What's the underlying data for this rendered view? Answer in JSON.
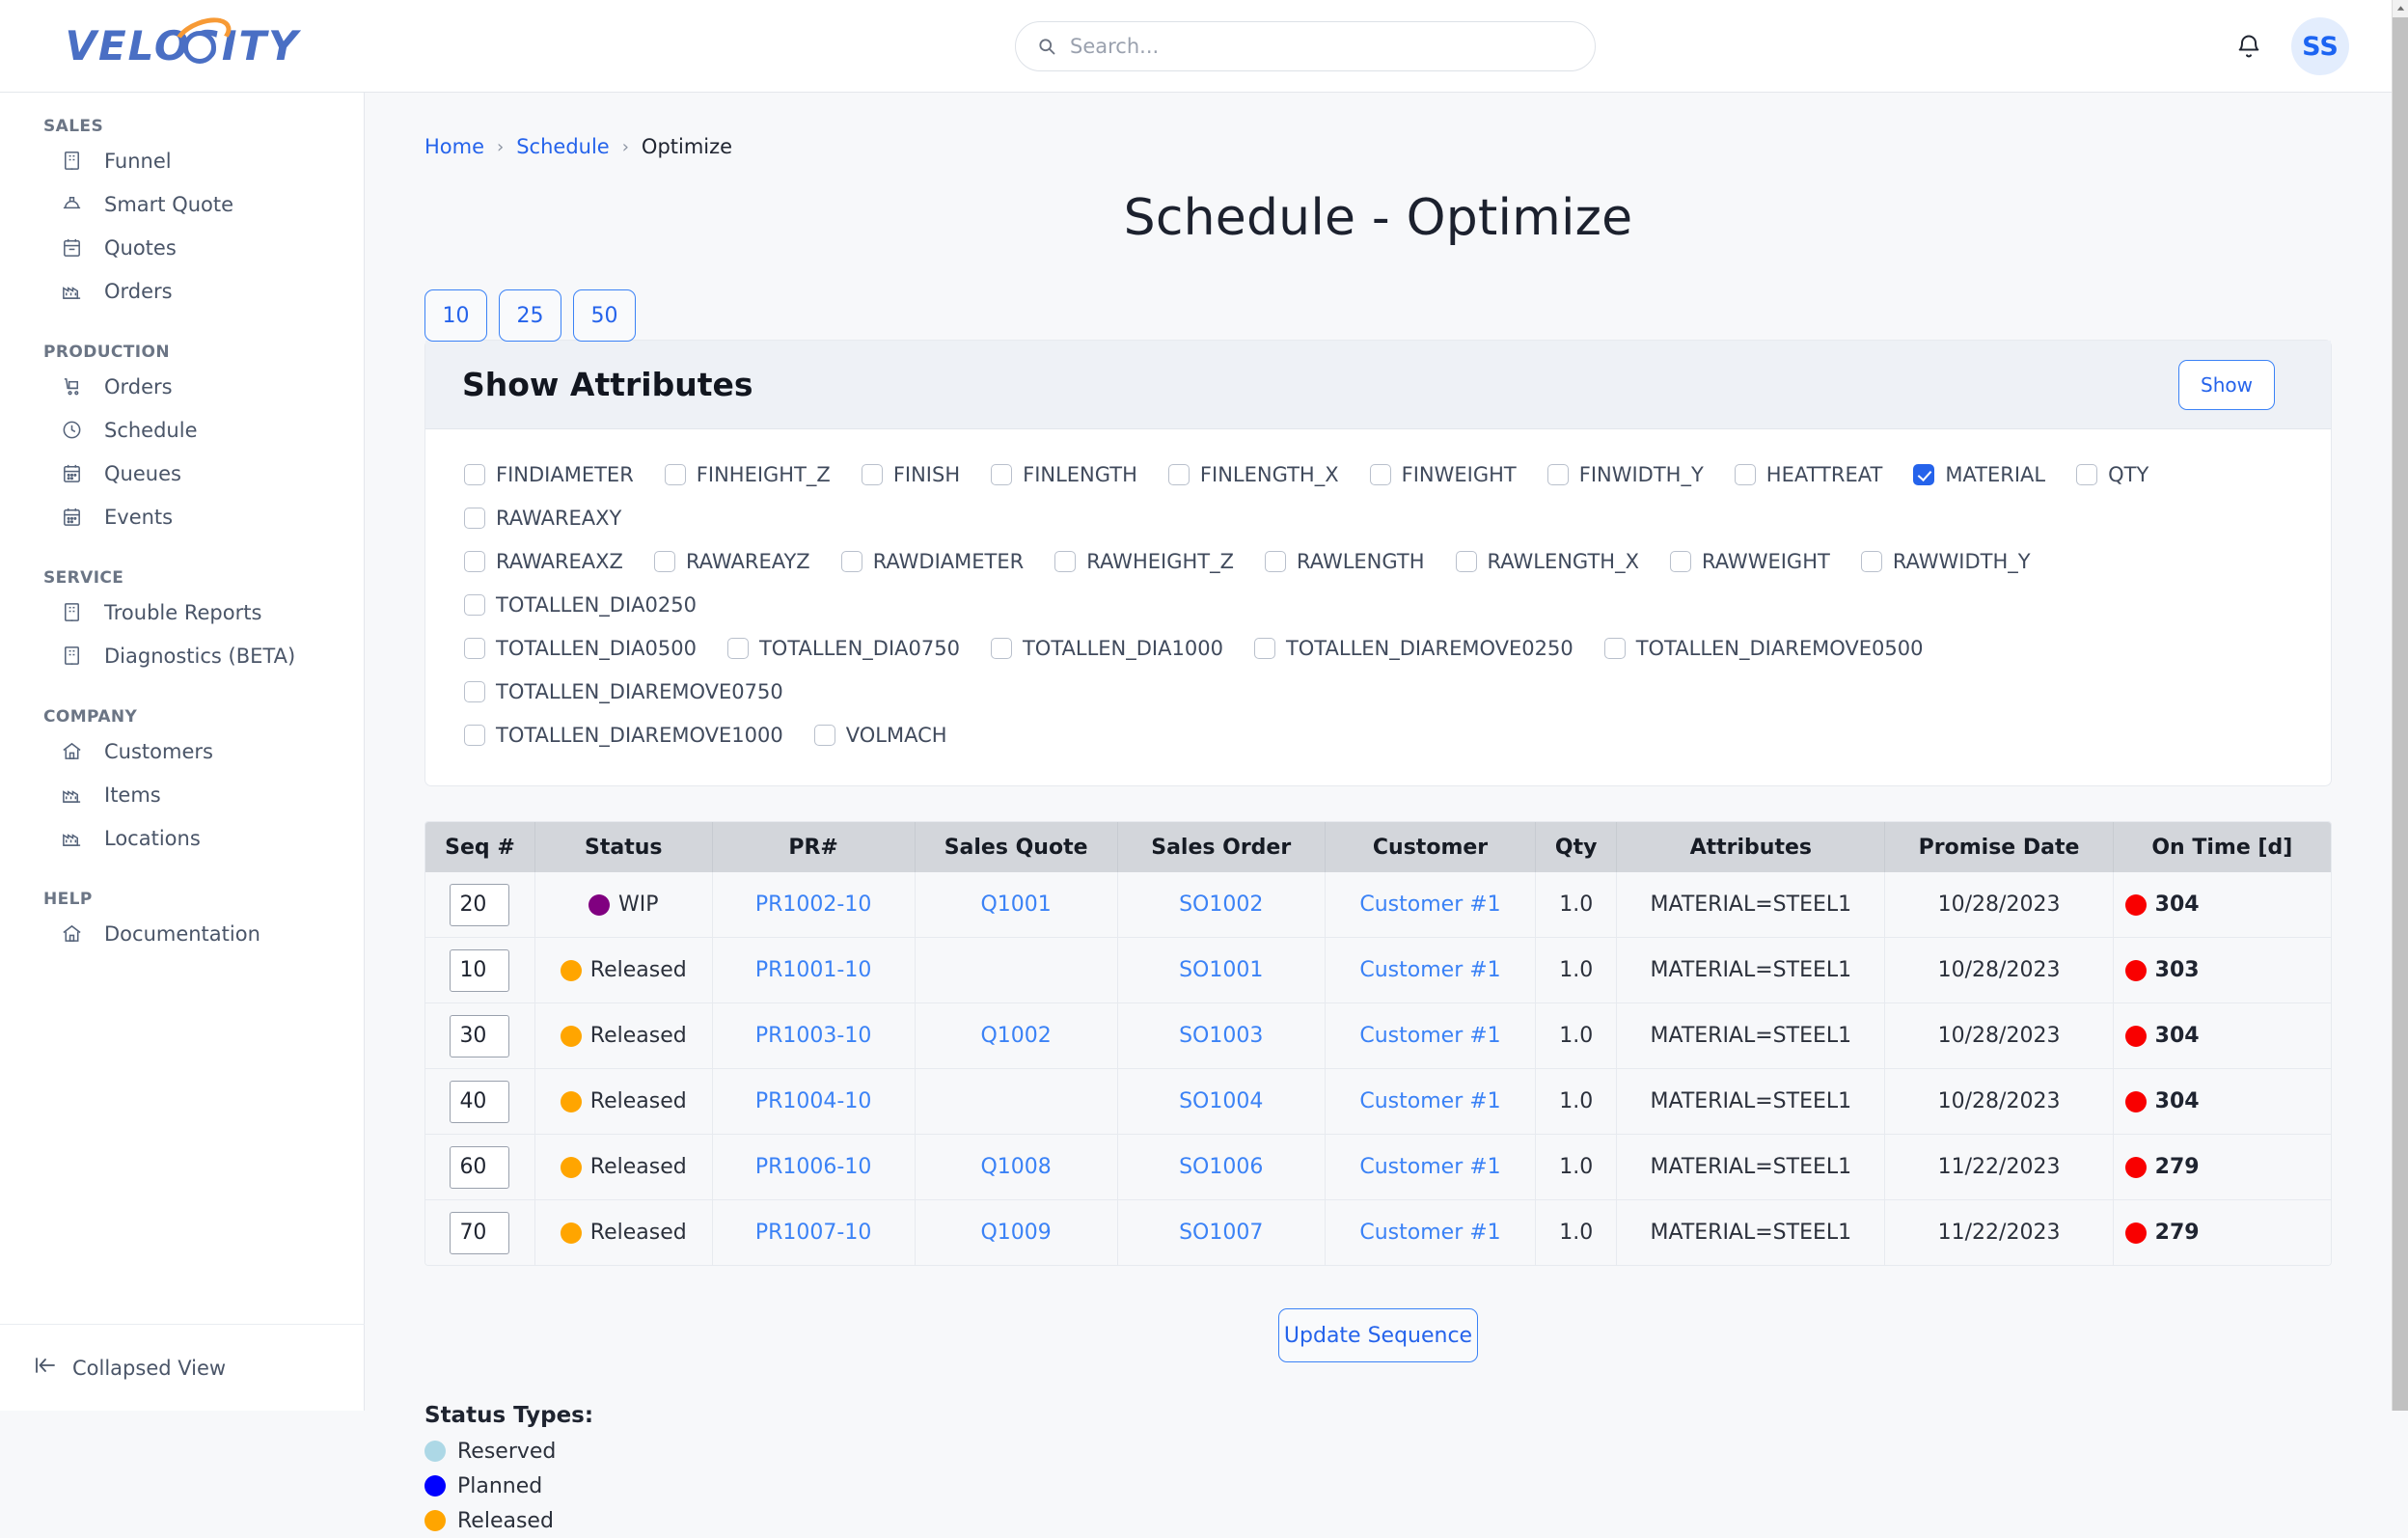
{
  "brand": {
    "logo_text": "VELOSITY",
    "logo_color": "#4a6fc4",
    "accent_color": "#f79a35"
  },
  "topbar": {
    "search_placeholder": "Search...",
    "avatar_initials": "SS"
  },
  "sidebar": {
    "groups": [
      {
        "title": "SALES",
        "items": [
          {
            "label": "Funnel",
            "icon": "building-icon"
          },
          {
            "label": "Smart Quote",
            "icon": "hardhat-icon"
          },
          {
            "label": "Quotes",
            "icon": "calendar-icon"
          },
          {
            "label": "Orders",
            "icon": "factory-icon"
          }
        ]
      },
      {
        "title": "PRODUCTION",
        "items": [
          {
            "label": "Orders",
            "icon": "cart-icon"
          },
          {
            "label": "Schedule",
            "icon": "clock-icon"
          },
          {
            "label": "Queues",
            "icon": "calendar-grid-icon"
          },
          {
            "label": "Events",
            "icon": "calendar-grid-icon"
          }
        ]
      },
      {
        "title": "SERVICE",
        "items": [
          {
            "label": "Trouble Reports",
            "icon": "building-icon"
          },
          {
            "label": "Diagnostics (BETA)",
            "icon": "building-icon"
          }
        ]
      },
      {
        "title": "COMPANY",
        "items": [
          {
            "label": "Customers",
            "icon": "home-icon"
          },
          {
            "label": "Items",
            "icon": "factory-icon"
          },
          {
            "label": "Locations",
            "icon": "factory-icon"
          }
        ]
      },
      {
        "title": "HELP",
        "items": [
          {
            "label": "Documentation",
            "icon": "home-icon"
          }
        ]
      }
    ],
    "collapse_label": "Collapsed View"
  },
  "breadcrumb": {
    "home": "Home",
    "schedule": "Schedule",
    "current": "Optimize",
    "separator": "›"
  },
  "page": {
    "title": "Schedule - Optimize"
  },
  "page_sizes": [
    "10",
    "25",
    "50"
  ],
  "attributes_panel": {
    "title": "Show Attributes",
    "show_label": "Show",
    "items": [
      {
        "label": "FINDIAMETER",
        "checked": false
      },
      {
        "label": "FINHEIGHT_Z",
        "checked": false
      },
      {
        "label": "FINISH",
        "checked": false
      },
      {
        "label": "FINLENGTH",
        "checked": false
      },
      {
        "label": "FINLENGTH_X",
        "checked": false
      },
      {
        "label": "FINWEIGHT",
        "checked": false
      },
      {
        "label": "FINWIDTH_Y",
        "checked": false
      },
      {
        "label": "HEATTREAT",
        "checked": false
      },
      {
        "label": "MATERIAL",
        "checked": true
      },
      {
        "label": "QTY",
        "checked": false
      },
      {
        "label": "RAWAREAXY",
        "checked": false
      },
      {
        "label": "RAWAREAXZ",
        "checked": false
      },
      {
        "label": "RAWAREAYZ",
        "checked": false
      },
      {
        "label": "RAWDIAMETER",
        "checked": false
      },
      {
        "label": "RAWHEIGHT_Z",
        "checked": false
      },
      {
        "label": "RAWLENGTH",
        "checked": false
      },
      {
        "label": "RAWLENGTH_X",
        "checked": false
      },
      {
        "label": "RAWWEIGHT",
        "checked": false
      },
      {
        "label": "RAWWIDTH_Y",
        "checked": false
      },
      {
        "label": "TOTALLEN_DIA0250",
        "checked": false
      },
      {
        "label": "TOTALLEN_DIA0500",
        "checked": false
      },
      {
        "label": "TOTALLEN_DIA0750",
        "checked": false
      },
      {
        "label": "TOTALLEN_DIA1000",
        "checked": false
      },
      {
        "label": "TOTALLEN_DIAREMOVE0250",
        "checked": false
      },
      {
        "label": "TOTALLEN_DIAREMOVE0500",
        "checked": false
      },
      {
        "label": "TOTALLEN_DIAREMOVE0750",
        "checked": false
      },
      {
        "label": "TOTALLEN_DIAREMOVE1000",
        "checked": false
      },
      {
        "label": "VOLMACH",
        "checked": false
      }
    ]
  },
  "table": {
    "columns": [
      "Seq #",
      "Status",
      "PR#",
      "Sales Quote",
      "Sales Order",
      "Customer",
      "Qty",
      "Attributes",
      "Promise Date",
      "On Time [d]"
    ],
    "rows": [
      {
        "seq": "20",
        "status": "WIP",
        "status_color": "#800080",
        "pr": "PR1002-10",
        "quote": "Q1001",
        "order": "SO1002",
        "customer": "Customer #1",
        "qty": "1.0",
        "attributes": "MATERIAL=STEEL1",
        "promise_date": "10/28/2023",
        "ontime": "304",
        "ontime_color": "#f90000"
      },
      {
        "seq": "10",
        "status": "Released",
        "status_color": "#FFA500",
        "pr": "PR1001-10",
        "quote": "",
        "order": "SO1001",
        "customer": "Customer #1",
        "qty": "1.0",
        "attributes": "MATERIAL=STEEL1",
        "promise_date": "10/28/2023",
        "ontime": "303",
        "ontime_color": "#f90000"
      },
      {
        "seq": "30",
        "status": "Released",
        "status_color": "#FFA500",
        "pr": "PR1003-10",
        "quote": "Q1002",
        "order": "SO1003",
        "customer": "Customer #1",
        "qty": "1.0",
        "attributes": "MATERIAL=STEEL1",
        "promise_date": "10/28/2023",
        "ontime": "304",
        "ontime_color": "#f90000"
      },
      {
        "seq": "40",
        "status": "Released",
        "status_color": "#FFA500",
        "pr": "PR1004-10",
        "quote": "",
        "order": "SO1004",
        "customer": "Customer #1",
        "qty": "1.0",
        "attributes": "MATERIAL=STEEL1",
        "promise_date": "10/28/2023",
        "ontime": "304",
        "ontime_color": "#f90000"
      },
      {
        "seq": "60",
        "status": "Released",
        "status_color": "#FFA500",
        "pr": "PR1006-10",
        "quote": "Q1008",
        "order": "SO1006",
        "customer": "Customer #1",
        "qty": "1.0",
        "attributes": "MATERIAL=STEEL1",
        "promise_date": "11/22/2023",
        "ontime": "279",
        "ontime_color": "#f90000"
      },
      {
        "seq": "70",
        "status": "Released",
        "status_color": "#FFA500",
        "pr": "PR1007-10",
        "quote": "Q1009",
        "order": "SO1007",
        "customer": "Customer #1",
        "qty": "1.0",
        "attributes": "MATERIAL=STEEL1",
        "promise_date": "11/22/2023",
        "ontime": "279",
        "ontime_color": "#f90000"
      }
    ]
  },
  "update_button": "Update Sequence",
  "status_types": {
    "title": "Status Types:",
    "items": [
      {
        "label": "Reserved",
        "color": "#ADD8E6"
      },
      {
        "label": "Planned",
        "color": "#0000FF"
      },
      {
        "label": "Released",
        "color": "#FFA500"
      }
    ]
  }
}
